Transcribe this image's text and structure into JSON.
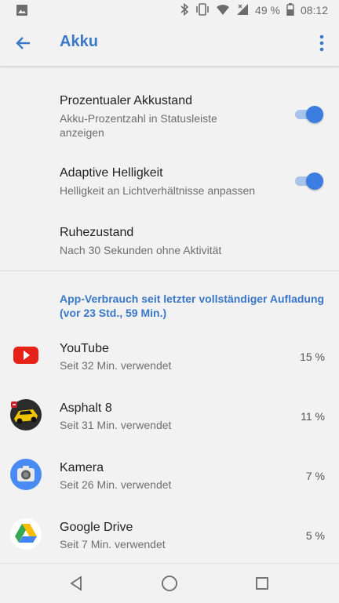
{
  "status_bar": {
    "battery_percent": "49 %",
    "time": "08:12",
    "icons": [
      "image-icon",
      "bluetooth-icon",
      "vibrate-icon",
      "wifi-icon",
      "signal-icon",
      "battery-icon"
    ]
  },
  "app_bar": {
    "title": "Akku",
    "back_icon": "arrow-back-icon",
    "menu_icon": "more-vert-icon"
  },
  "settings": [
    {
      "title": "Prozentualer Akkustand",
      "subtitle": "Akku-Prozentzahl in Statusleiste anzeigen",
      "toggle_on": true
    },
    {
      "title": "Adaptive Helligkeit",
      "subtitle": "Helligkeit an Lichtverhältnisse anpassen",
      "toggle_on": true
    },
    {
      "title": "Ruhezustand",
      "subtitle": "Nach 30 Sekunden ohne Aktivität"
    }
  ],
  "usage_header": "App-Verbrauch seit letzter vollständiger Aufladung (vor 23 Std., 59 Min.)",
  "apps": [
    {
      "name": "YouTube",
      "usage": "Seit 32 Min. verwendet",
      "percent": "15 %",
      "icon": "youtube-icon"
    },
    {
      "name": "Asphalt 8",
      "usage": "Seit 31 Min. verwendet",
      "percent": "11 %",
      "icon": "asphalt-icon"
    },
    {
      "name": "Kamera",
      "usage": "Seit 26 Min. verwendet",
      "percent": "7 %",
      "icon": "camera-icon"
    },
    {
      "name": "Google Drive",
      "usage": "Seit 7 Min. verwendet",
      "percent": "5 %",
      "icon": "google-drive-icon"
    }
  ],
  "nav_bar": {
    "icons": [
      "back-triangle-icon",
      "home-circle-icon",
      "recents-square-icon"
    ]
  },
  "colors": {
    "accent": "#3b78c8",
    "toggle_thumb": "#3b7de0",
    "toggle_track": "#a9c4ea",
    "background": "#f2f2f2"
  }
}
